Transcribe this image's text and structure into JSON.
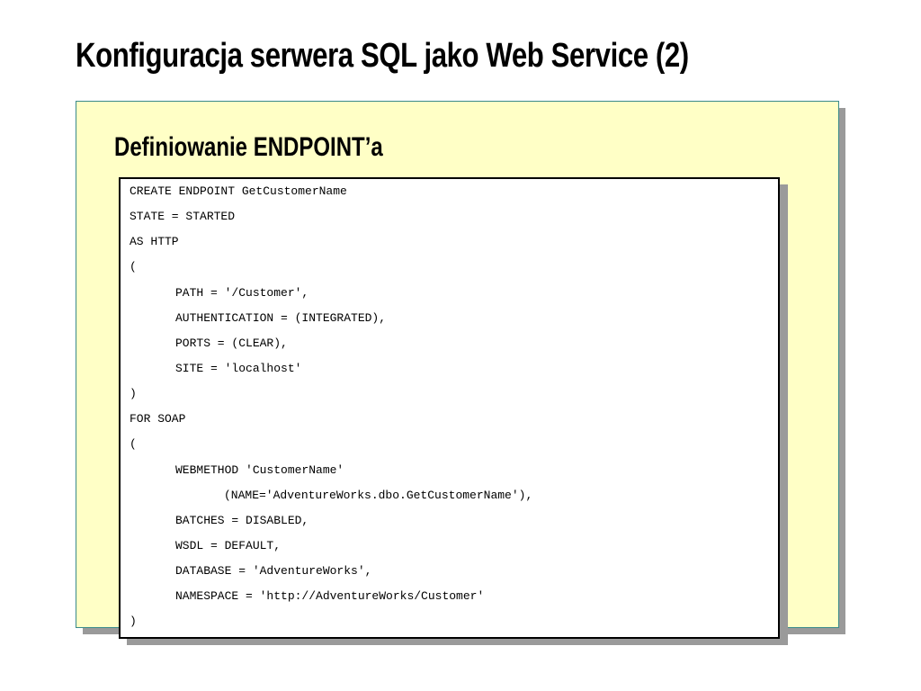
{
  "slide": {
    "title": "Konfiguracja serwera SQL jako Web Service (2)",
    "section_heading": "Definiowanie ENDPOINT’a"
  },
  "code": {
    "lines": [
      {
        "text": "CREATE ENDPOINT GetCustomerName",
        "indent": 0
      },
      {
        "text": "STATE = STARTED",
        "indent": 0
      },
      {
        "text": "AS HTTP",
        "indent": 0
      },
      {
        "text": "(",
        "indent": 0
      },
      {
        "text": "PATH = '/Customer',",
        "indent": 1
      },
      {
        "text": "AUTHENTICATION = (INTEGRATED),",
        "indent": 1
      },
      {
        "text": "PORTS = (CLEAR),",
        "indent": 1
      },
      {
        "text": "SITE = 'localhost'",
        "indent": 1
      },
      {
        "text": ")",
        "indent": 0
      },
      {
        "text": "FOR SOAP",
        "indent": 0
      },
      {
        "text": "(",
        "indent": 0
      },
      {
        "text": "WEBMETHOD 'CustomerName'",
        "indent": 1
      },
      {
        "text": "(NAME='AdventureWorks.dbo.GetCustomerName'),",
        "indent": 2
      },
      {
        "text": "BATCHES = DISABLED,",
        "indent": 1
      },
      {
        "text": "WSDL = DEFAULT,",
        "indent": 1
      },
      {
        "text": "DATABASE = 'AdventureWorks',",
        "indent": 1
      },
      {
        "text": "NAMESPACE = 'http://AdventureWorks/Customer'",
        "indent": 1
      },
      {
        "text": ")",
        "indent": 0
      }
    ]
  },
  "colors": {
    "panel_background": "#ffffc6",
    "panel_border": "#3a8a8a",
    "shadow": "#9a9a9a",
    "code_background": "#ffffff",
    "text": "#000000"
  }
}
